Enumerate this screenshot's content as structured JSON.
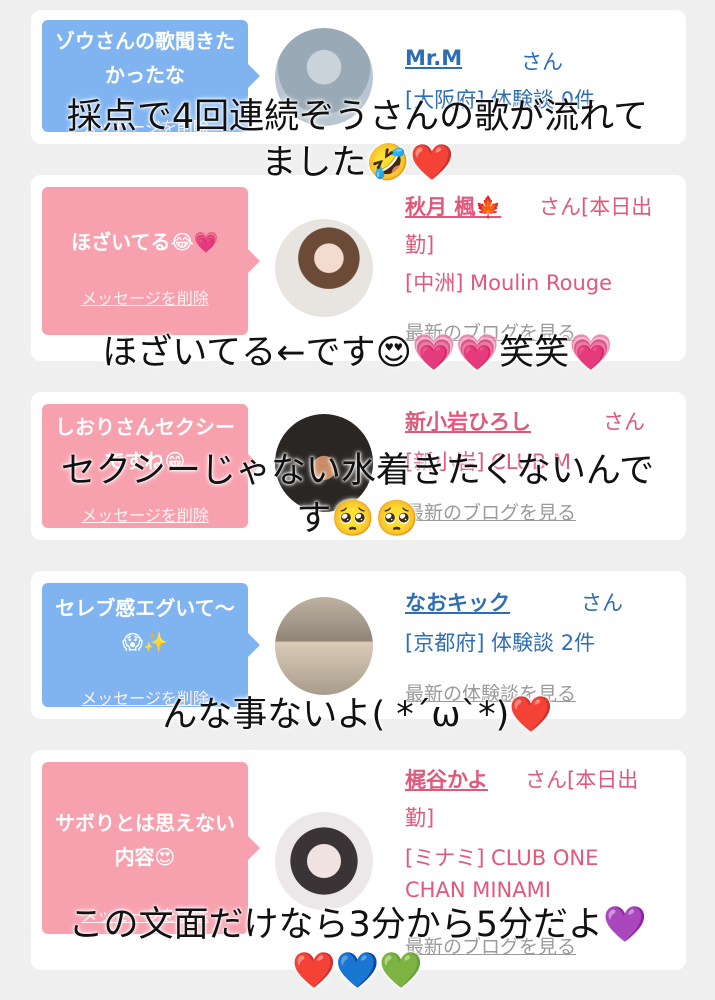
{
  "cards": [
    {
      "bubble": "ゾウさんの歌聞きたかったな",
      "delete_label": "メッセージを削除",
      "name": "Mr.M",
      "san": "さん",
      "meta": "[大阪府] 体験談 0件",
      "link": "",
      "colors": {
        "bubble": "#7fb4f1",
        "name": "#2e6db4"
      }
    },
    {
      "bubble": "ほざいてる😂💗",
      "delete_label": "メッセージを削除",
      "name": "秋月 楓🍁",
      "san": "さん[本日出",
      "san2": "勤]",
      "meta": "[中洲] Moulin Rouge",
      "link": "最新のブログを見る",
      "colors": {
        "bubble": "#f7a1ae",
        "name": "#e0587a"
      }
    },
    {
      "bubble": "しおりさんセクシーですね😁",
      "delete_label": "メッセージを削除",
      "name": "新小岩ひろし",
      "san": "さん",
      "meta": "[新小岩] CLUB M",
      "link": "最新のブログを見る",
      "colors": {
        "bubble": "#f7a1ae",
        "name": "#e0587a"
      }
    },
    {
      "bubble": "セレブ感エグいて〜😱✨",
      "delete_label": "メッセージを削除",
      "name": "なおキック",
      "san": "さん",
      "meta": "[京都府] 体験談 2件",
      "link": "最新の体験談を見る",
      "colors": {
        "bubble": "#7fb4f1",
        "name": "#2e6db4"
      }
    },
    {
      "bubble": "サボりとは思えない内容😍",
      "delete_label": "メッセージを削除",
      "name": "梶谷かよ",
      "san": "さん[本日出",
      "san2": "勤]",
      "meta": "[ミナミ] CLUB ONE",
      "meta2": "CHAN MINAMI",
      "link": "最新のブログを見る",
      "colors": {
        "bubble": "#f7a1ae",
        "name": "#e0587a"
      }
    }
  ],
  "captions": [
    "採点で4回連続ぞうさんの歌が流れて",
    "ました🤣❤️",
    "ほざいてる←です😍💗💗笑笑💗",
    "セクシーじゃない水着きたくないんで",
    "す🥺🥺",
    "んな事ないよ( *´ω`*)❤️",
    "この文面だけなら3分から5分だよ💜",
    "❤️💙💚"
  ]
}
